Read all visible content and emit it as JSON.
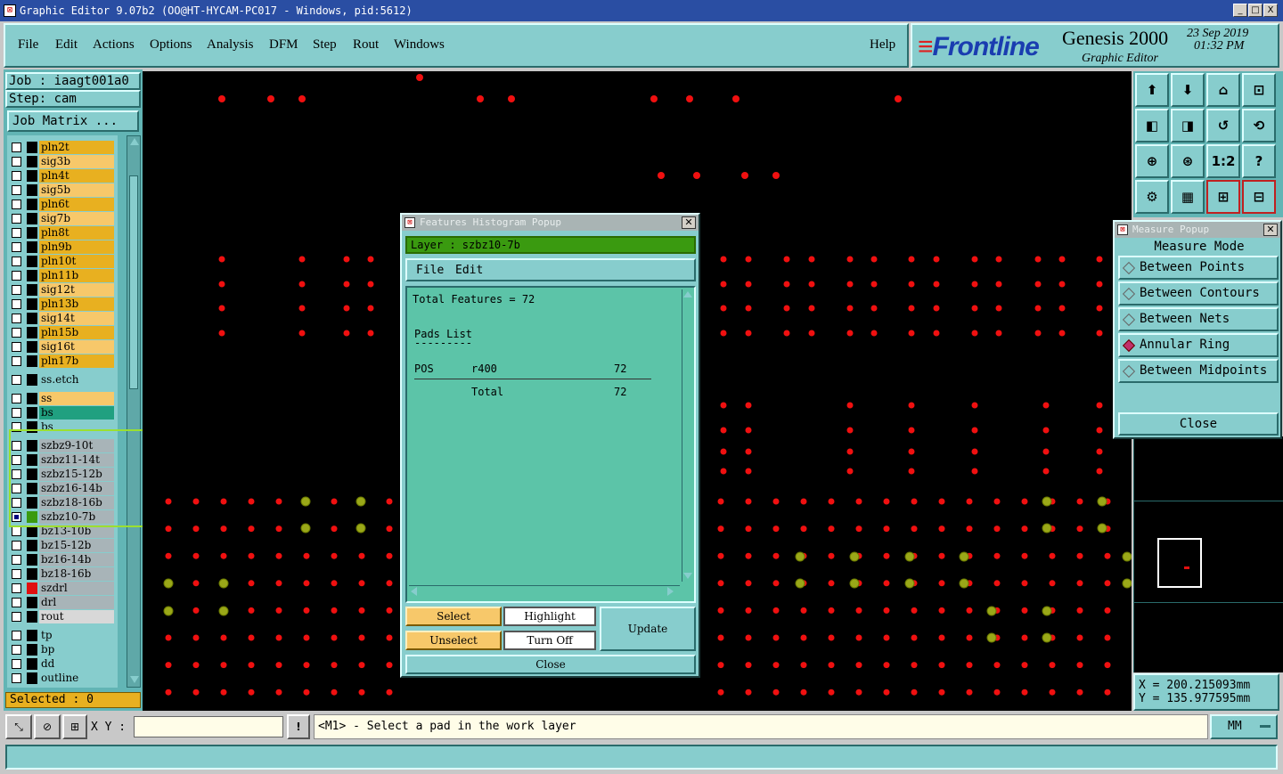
{
  "window": {
    "title": "Graphic Editor 9.07b2 (OO@HT-HYCAM-PC017 - Windows, pid:5612)",
    "controls": [
      "_",
      "□",
      "X"
    ]
  },
  "menu": {
    "items": [
      "File",
      "Edit",
      "Actions",
      "Options",
      "Analysis",
      "DFM",
      "Step",
      "Rout",
      "Windows"
    ],
    "help": "Help"
  },
  "brand": {
    "logo": "Frontline",
    "product": "Genesis 2000",
    "subtitle": "Graphic Editor",
    "date": "23 Sep 2019",
    "time": "01:32 PM"
  },
  "job": {
    "job_label": "Job : iaagt001a0",
    "step_label": "Step: cam",
    "matrix_button": "Job Matrix ..."
  },
  "layers": {
    "group1": [
      {
        "name": "pln2t",
        "color": "#e8b020"
      },
      {
        "name": "sig3b",
        "color": "#f7c86a"
      },
      {
        "name": "pln4t",
        "color": "#e8b020"
      },
      {
        "name": "sig5b",
        "color": "#f7c86a"
      },
      {
        "name": "pln6t",
        "color": "#e8b020"
      },
      {
        "name": "sig7b",
        "color": "#f7c86a"
      },
      {
        "name": "pln8t",
        "color": "#e8b020"
      },
      {
        "name": "pln9b",
        "color": "#e8b020"
      },
      {
        "name": "pln10t",
        "color": "#e8b020"
      },
      {
        "name": "pln11b",
        "color": "#e8b020"
      },
      {
        "name": "sig12t",
        "color": "#f7c86a"
      },
      {
        "name": "pln13b",
        "color": "#e8b020"
      },
      {
        "name": "sig14t",
        "color": "#f7c86a"
      },
      {
        "name": "pln15b",
        "color": "#e8b020"
      },
      {
        "name": "sig16t",
        "color": "#f7c86a"
      },
      {
        "name": "pln17b",
        "color": "#e8b020"
      }
    ],
    "group2": [
      {
        "name": "ss.etch",
        "color": "#87cdcd"
      }
    ],
    "group3": [
      {
        "name": "ss",
        "color": "#f7c86a"
      },
      {
        "name": "bs",
        "color": "#20a080"
      },
      {
        "name": "bs",
        "color": "#87cdcd"
      }
    ],
    "group4": [
      {
        "name": "szbz9-10t",
        "color": "#a8b4b8"
      },
      {
        "name": "szbz11-14t",
        "color": "#a8b4b8"
      },
      {
        "name": "szbz15-12b",
        "color": "#a8b4b8"
      },
      {
        "name": "szbz16-14b",
        "color": "#a8b4b8"
      },
      {
        "name": "szbz18-16b",
        "color": "#a8b4b8"
      },
      {
        "name": "szbz10-7b",
        "color": "#a8b4b8",
        "active": true
      },
      {
        "name": "bz13-10b",
        "color": "#a8b4b8"
      },
      {
        "name": "bz15-12b",
        "color": "#a8b4b8"
      },
      {
        "name": "bz16-14b",
        "color": "#a8b4b8"
      },
      {
        "name": "bz18-16b",
        "color": "#a8b4b8"
      },
      {
        "name": "szdrl",
        "color": "#a8b4b8",
        "tag": "#e01010"
      },
      {
        "name": "drl",
        "color": "#a8b4b8"
      },
      {
        "name": "rout",
        "color": "#d8d8d8"
      }
    ],
    "group5": [
      {
        "name": "tp",
        "color": "#87cdcd"
      },
      {
        "name": "bp",
        "color": "#87cdcd"
      },
      {
        "name": "dd",
        "color": "#87cdcd"
      },
      {
        "name": "outline",
        "color": "#87cdcd"
      }
    ],
    "selected": "Selected : 0"
  },
  "histogram": {
    "title": "Features Histogram Popup",
    "layer": "Layer :  szbz10-7b",
    "menu": [
      "File",
      "Edit"
    ],
    "total": "Total Features = 72",
    "pads_title": "Pads List",
    "pads_rule": "---------",
    "row_pos": "POS",
    "row_sym": "r400",
    "row_count": "72",
    "total_label": "Total",
    "total_count": "72",
    "buttons": {
      "select": "Select",
      "highlight": "Highlight",
      "update": "Update",
      "unselect": "Unselect",
      "turn_off": "Turn Off",
      "close": "Close"
    }
  },
  "measure": {
    "title": "Measure Popup",
    "mode_label": "Measure Mode",
    "options": [
      {
        "label": "Between Points",
        "selected": false
      },
      {
        "label": "Between Contours",
        "selected": false
      },
      {
        "label": "Between Nets",
        "selected": false
      },
      {
        "label": "Annular Ring",
        "selected": true
      },
      {
        "label": "Between Midpoints",
        "selected": false
      }
    ],
    "close": "Close"
  },
  "coords": {
    "x": "X =  200.215093mm",
    "y": "Y =  135.977595mm"
  },
  "statusbar": {
    "xy_label": "X Y :",
    "xy_value": "",
    "message": "<M1> - Select a pad in the work layer",
    "units": "MM"
  },
  "tool_icons": [
    "zoom-home-icon",
    "zoom-back-icon",
    "home-icon",
    "zoom-xy-icon",
    "pan-left-icon",
    "pan-right-icon",
    "mirror-icon",
    "snap-icon",
    "fit-icon",
    "center-icon",
    "scale-icon",
    "help-icon",
    "settings-icon",
    "grid-icon",
    "layers-a-icon",
    "layers-b-icon"
  ],
  "tool_labels": [
    "",
    "",
    "",
    "",
    "",
    "",
    "",
    "",
    "",
    "",
    "1:2",
    "?",
    "",
    "",
    "",
    ""
  ]
}
